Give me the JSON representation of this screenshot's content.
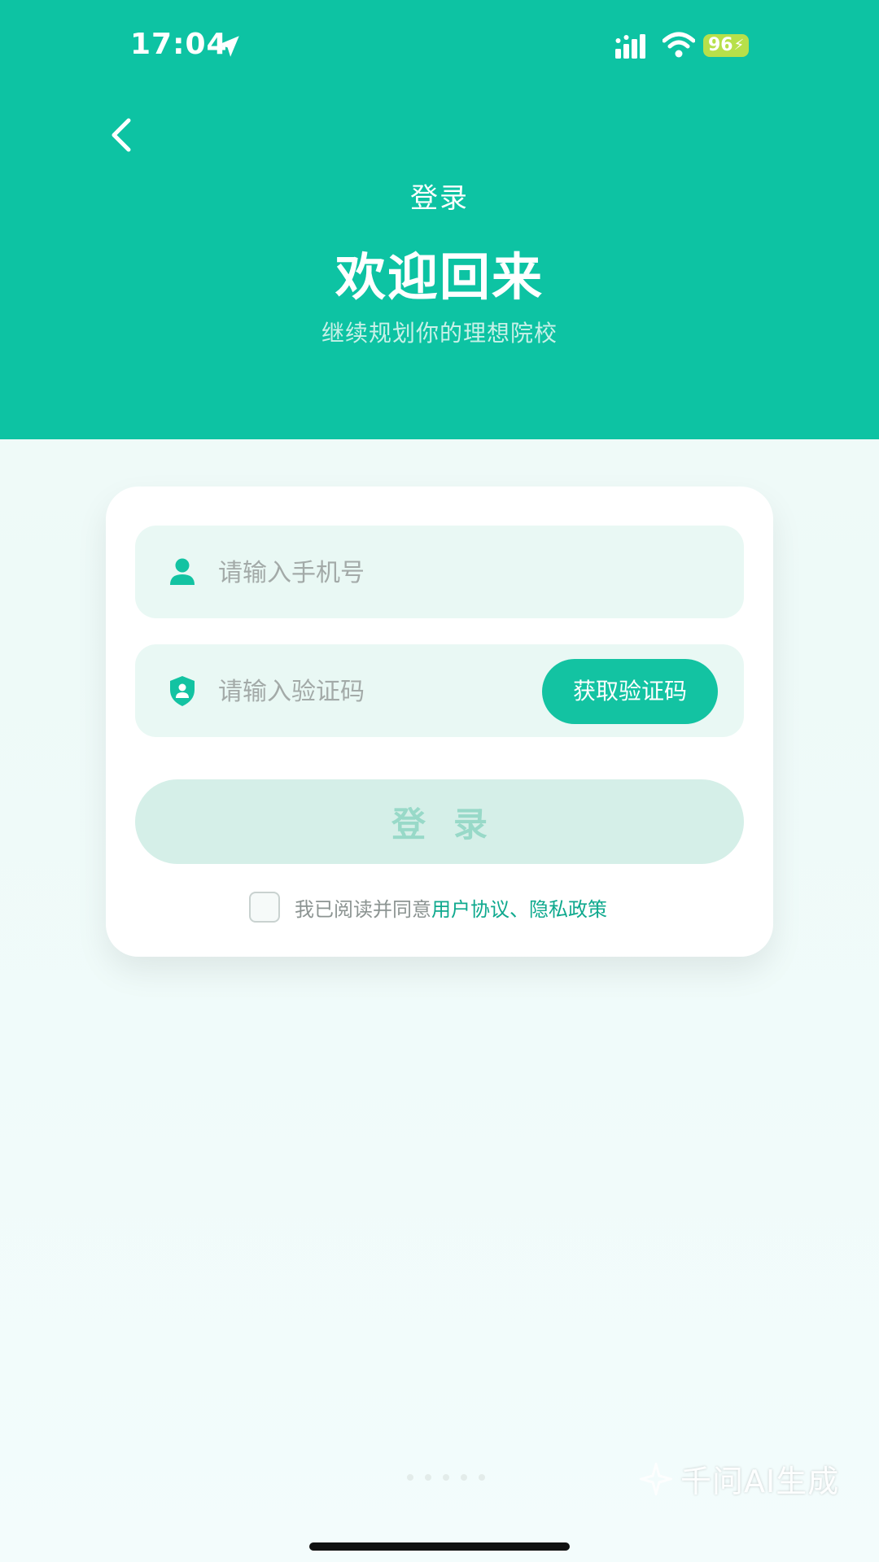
{
  "status_bar": {
    "time": "17:04",
    "battery": "96"
  },
  "header": {
    "nav_title": "登录",
    "welcome": "欢迎回来",
    "subtitle": "继续规划你的理想院校"
  },
  "form": {
    "phone_placeholder": "请输入手机号",
    "phone_value": "",
    "code_placeholder": "请输入验证码",
    "code_value": "",
    "get_code_label": "获取验证码",
    "login_label": "登录"
  },
  "agreement": {
    "checked": false,
    "prefix": "我已阅读并同意",
    "user_agreement": "用户协议",
    "separator": "、",
    "privacy_policy": "隐私政策"
  },
  "watermark": "千问AI生成",
  "icons": {
    "back": "chevron-left-icon",
    "user": "user-icon",
    "shield": "shield-user-icon",
    "location": "location-arrow-icon",
    "signal": "signal-icon",
    "wifi": "wifi-icon"
  },
  "colors": {
    "brand": "#0dc3a3",
    "button": "#13c3a2",
    "button_disabled": "#d5efe8",
    "link": "#0fa98e",
    "field_bg": "#e9f8f4"
  }
}
